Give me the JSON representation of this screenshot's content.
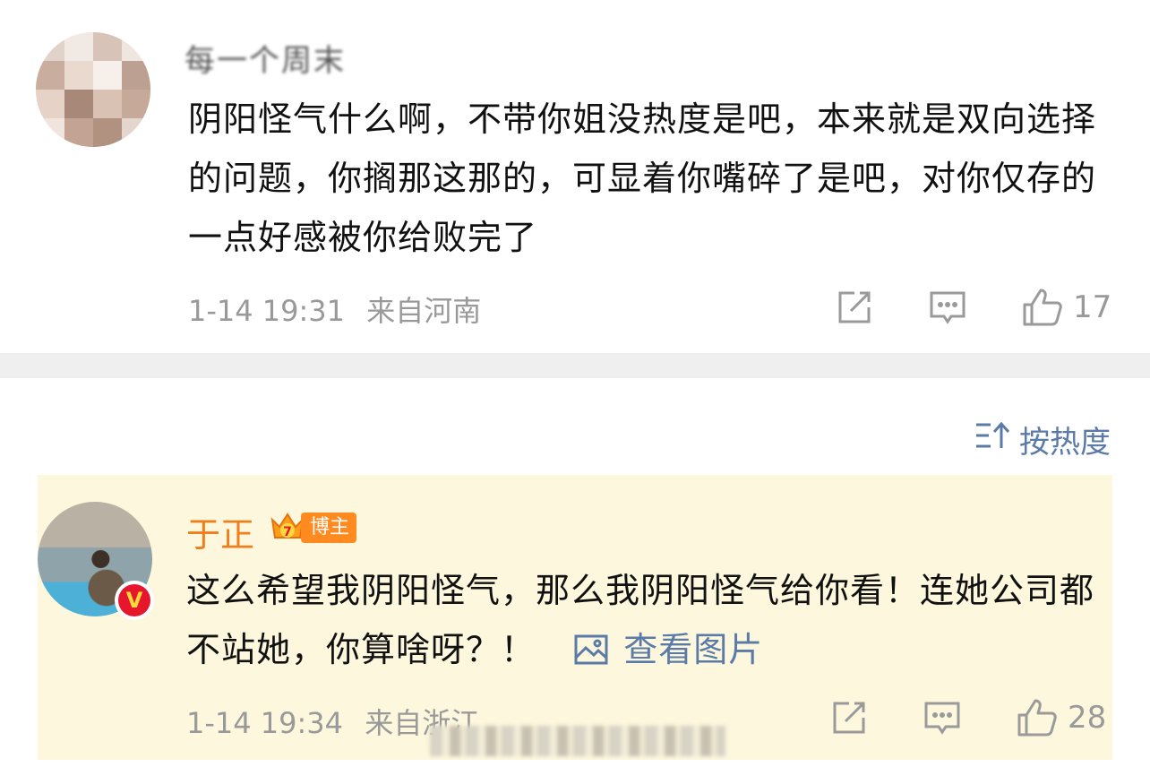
{
  "comment1": {
    "username": "每一个周末",
    "text": "阴阳怪气什么啊，不带你姐没热度是吧，本来就是双向选择的问题，你搁那这那的，可显着你嘴碎了是吧，对你仅存的一点好感被你给败完了",
    "timestamp": "1-14 19:31",
    "location": "来自河南",
    "like_count": "17"
  },
  "sort": {
    "label": "按热度"
  },
  "comment2": {
    "username": "于正",
    "badge": "博主",
    "crown_level": "7",
    "verified_mark": "V",
    "text": "这么希望我阴阳怪气，那么我阴阳怪气给你看！连她公司都不站她，你算啥呀？！",
    "view_pic_label": "查看图片",
    "timestamp": "1-14 19:34",
    "location": "来自浙江",
    "like_count": "28"
  },
  "colors": {
    "link_blue": "#5a7ba8",
    "author_orange": "#f07e1b",
    "highlight_bg": "#fdf7dd",
    "separator": "#efefef",
    "meta_gray": "#999999"
  },
  "icons": [
    "share-icon",
    "comment-icon",
    "like-icon",
    "sort-icon",
    "image-icon",
    "crown-icon",
    "verified-icon"
  ]
}
